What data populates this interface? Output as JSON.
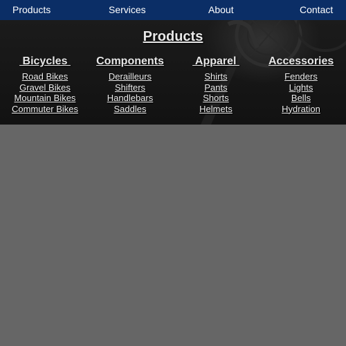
{
  "nav": {
    "items": [
      {
        "label": "Products"
      },
      {
        "label": "Services"
      },
      {
        "label": "About"
      },
      {
        "label": "Contact"
      }
    ]
  },
  "menu": {
    "title": "Products",
    "columns": [
      {
        "heading": " Bicycles ",
        "links": [
          "Road Bikes",
          "Gravel Bikes",
          "Mountain Bikes",
          "Commuter Bikes"
        ]
      },
      {
        "heading": "Components",
        "links": [
          "Derailleurs",
          "Shifters",
          "Handlebars",
          "Saddles"
        ]
      },
      {
        "heading": " Apparel ",
        "links": [
          "Shirts",
          "Pants",
          "Shorts",
          "Helmets"
        ]
      },
      {
        "heading": "Accessories",
        "links": [
          "Fenders",
          "Lights",
          "Bells",
          "Hydration"
        ]
      }
    ]
  },
  "colors": {
    "nav_bar": "#0b2e66",
    "page_background": "#666666",
    "menu_background": "#141414",
    "text": "#ffffff"
  }
}
